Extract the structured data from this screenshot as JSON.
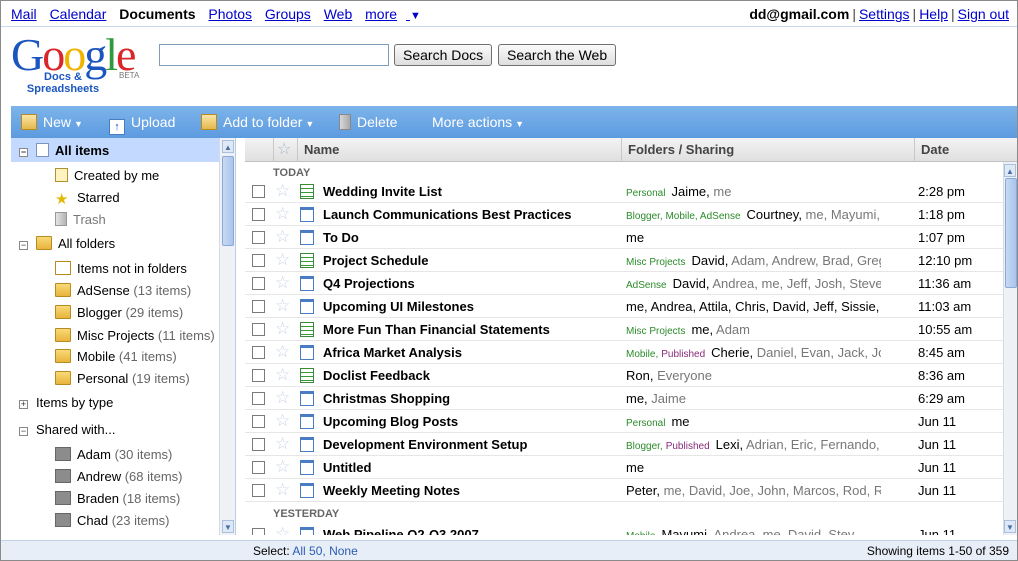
{
  "nav": {
    "links": [
      "Mail",
      "Calendar",
      "Documents",
      "Photos",
      "Groups",
      "Web",
      "more"
    ],
    "current": "Documents",
    "email": "dd@gmail.com",
    "settings": "Settings",
    "help": "Help",
    "signout": "Sign out"
  },
  "header": {
    "logo_text": "Google",
    "logo_sub_line1": "Docs &",
    "logo_sub_line2": "Spreadsheets",
    "beta": "BETA",
    "search_value": "",
    "search_docs_btn": "Search Docs",
    "search_web_btn": "Search the Web"
  },
  "toolbar": {
    "new": "New",
    "upload": "Upload",
    "add_to_folder": "Add to folder",
    "delete": "Delete",
    "more_actions": "More actions"
  },
  "sidebar": {
    "all_items": "All items",
    "created_by_me": "Created by me",
    "starred": "Starred",
    "trash": "Trash",
    "all_folders": "All folders",
    "items_not_in_folders": "Items not in folders",
    "folders": [
      {
        "name": "AdSense",
        "count": "(13 items)"
      },
      {
        "name": "Blogger",
        "count": "(29 items)"
      },
      {
        "name": "Misc Projects",
        "count": "(11 items)"
      },
      {
        "name": "Mobile",
        "count": "(41 items)"
      },
      {
        "name": "Personal",
        "count": "(19 items)"
      }
    ],
    "items_by_type": "Items by type",
    "shared_with": "Shared with...",
    "people": [
      {
        "name": "Adam",
        "count": "(30 items)"
      },
      {
        "name": "Andrew",
        "count": "(68 items)"
      },
      {
        "name": "Braden",
        "count": "(18 items)"
      },
      {
        "name": "Chad",
        "count": "(23 items)"
      }
    ]
  },
  "list": {
    "col_name": "Name",
    "col_folders": "Folders / Sharing",
    "col_date": "Date",
    "group_today": "TODAY",
    "group_yesterday": "YESTERDAY",
    "rows": [
      {
        "name": "Wedding Invite List",
        "type": "sheet",
        "tags": [
          {
            "t": "Personal",
            "c": "green"
          }
        ],
        "main": "Jaime,",
        "rest": " me",
        "date": "2:28 pm"
      },
      {
        "name": "Launch Communications Best Practices",
        "type": "doc",
        "tags": [
          {
            "t": "Blogger, Mobile, AdSense",
            "c": "green"
          }
        ],
        "main": "Courtney,",
        "rest": " me, Mayumi,",
        "date": "1:18 pm"
      },
      {
        "name": "To Do",
        "type": "doc",
        "tags": [],
        "main": "me",
        "rest": "",
        "date": "1:07 pm"
      },
      {
        "name": "Project Schedule",
        "type": "sheet",
        "tags": [
          {
            "t": "Misc Projects",
            "c": "green"
          }
        ],
        "main": "David,",
        "rest": " Adam, Andrew, Brad, Greg",
        "date": "12:10 pm"
      },
      {
        "name": "Q4 Projections",
        "type": "doc",
        "tags": [
          {
            "t": "AdSense",
            "c": "green"
          }
        ],
        "main": "David,",
        "rest": " Andrea, me, Jeff, Josh, Steven",
        "date": "11:36 am"
      },
      {
        "name": "Upcoming UI Milestones",
        "type": "doc",
        "tags": [],
        "main": "me, Andrea, Attila, Chris, David, Jeff, Sissie, To",
        "rest": "",
        "date": "11:03 am"
      },
      {
        "name": "More Fun Than Financial Statements",
        "type": "sheet",
        "tags": [
          {
            "t": "Misc Projects",
            "c": "green"
          }
        ],
        "main": "me,",
        "rest": " Adam",
        "date": "10:55 am"
      },
      {
        "name": "Africa Market Analysis",
        "type": "doc",
        "tags": [
          {
            "t": "Mobile,",
            "c": "green"
          },
          {
            "t": "Published",
            "c": "purple"
          }
        ],
        "main": "Cherie,",
        "rest": " Daniel, Evan, Jack, Jo",
        "date": "8:45 am"
      },
      {
        "name": "Doclist Feedback",
        "type": "sheet",
        "tags": [],
        "main": "Ron,",
        "rest": " Everyone",
        "date": "8:36 am"
      },
      {
        "name": "Christmas Shopping",
        "type": "doc",
        "tags": [],
        "main": "me,",
        "rest": " Jaime",
        "date": "6:29 am"
      },
      {
        "name": "Upcoming Blog Posts",
        "type": "doc",
        "tags": [
          {
            "t": "Personal",
            "c": "green"
          }
        ],
        "main": "me",
        "rest": "",
        "date": "Jun 11"
      },
      {
        "name": "Development Environment Setup",
        "type": "doc",
        "tags": [
          {
            "t": "Blogger,",
            "c": "green"
          },
          {
            "t": "Published",
            "c": "purple"
          }
        ],
        "main": "Lexi,",
        "rest": " Adrian, Eric, Fernando, (",
        "date": "Jun 11"
      },
      {
        "name": "Untitled",
        "type": "doc",
        "tags": [],
        "main": "me",
        "rest": "",
        "date": "Jun 11"
      },
      {
        "name": "Weekly Meeting Notes",
        "type": "doc",
        "tags": [],
        "main": "Peter,",
        "rest": " me, David, Joe, John, Marcos, Rod, Ron",
        "date": "Jun 11"
      },
      {
        "name": "Web Pipeline Q2-Q3 2007",
        "type": "doc",
        "tags": [
          {
            "t": "Mobile",
            "c": "green"
          }
        ],
        "main": "Mayumi,",
        "rest": " Andrea, me, David, Stev",
        "date": "Jun 11"
      }
    ]
  },
  "footer": {
    "select_label": "Select:",
    "select_all": "All 50,",
    "select_none": "None",
    "showing": "Showing items 1-50 of 359"
  }
}
